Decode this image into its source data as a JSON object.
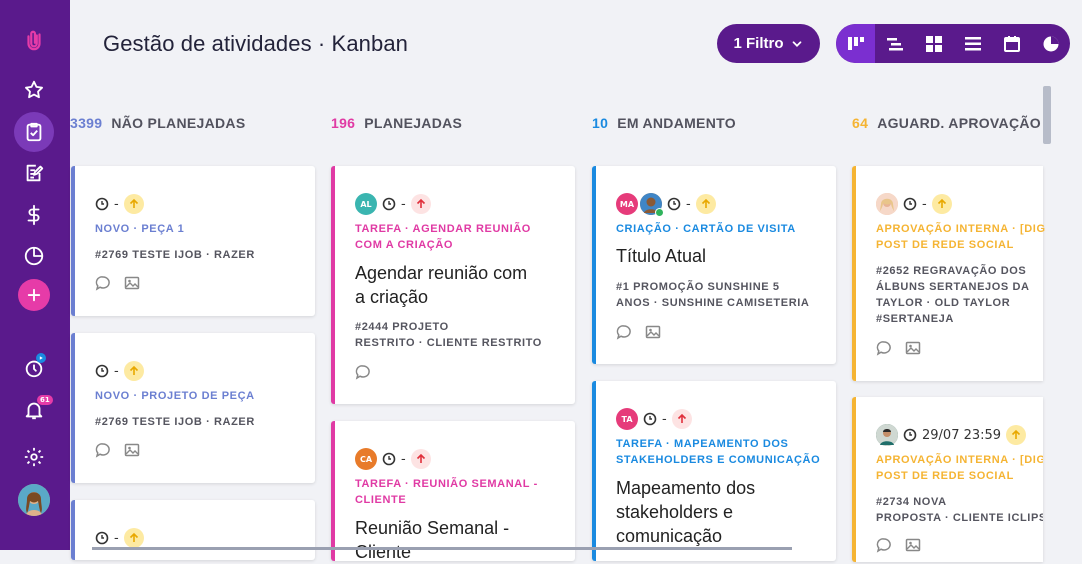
{
  "header": {
    "title": "Gestão de atividades · Kanban",
    "filter_label": "1 Filtro"
  },
  "views": [
    "kanban-icon",
    "gantt-icon",
    "grid-icon",
    "list-icon",
    "calendar-icon",
    "pie-chart-icon"
  ],
  "sidebar": {
    "items": [
      "logo-icon",
      "star-icon",
      "clipboard-check-icon",
      "edit-note-icon",
      "dollar-icon",
      "pie-chart-icon",
      "add-icon",
      "timer-icon",
      "bell-icon",
      "gear-icon",
      "avatar"
    ],
    "notification_badge": "61"
  },
  "colors": {
    "primary": "#5a1a8c",
    "accent": "#e63ba8",
    "blue": "#6b7fd1",
    "pink": "#e03aa4",
    "sky": "#1a8ae0",
    "amber": "#f5b433"
  },
  "columns": [
    {
      "count": "3399",
      "label": "NÃO PLANEJADAS",
      "count_color": "#6b7fd1"
    },
    {
      "count": "196",
      "label": "PLANEJADAS",
      "count_color": "#e03aa4"
    },
    {
      "count": "10",
      "label": "EM ANDAMENTO",
      "count_color": "#1a8ae0"
    },
    {
      "count": "64",
      "label": "AGUARD. APROVAÇÃO",
      "count_color": "#f5b433"
    }
  ],
  "cards": {
    "c1": {
      "due": "-",
      "category": "NOVO · PEÇA 1",
      "project_line1": "#2769 TESTE IJOB  ·  RAZER"
    },
    "c2": {
      "due": "-",
      "category": "NOVO · PROJETO DE PEÇA",
      "project_line1": "#2769 TESTE IJOB  ·  RAZER"
    },
    "c3": {
      "due": "-"
    },
    "p1": {
      "avatar": "AL",
      "due": "-",
      "category_line1": "TAREFA · AGENDAR REUNIÃO",
      "category_line2": "COM A CRIAÇÃO",
      "title_line1": "Agendar reunião com",
      "title_line2": "a criação",
      "project_line1": "#2444 PROJETO",
      "project_line2": "RESTRITO  ·  CLIENTE RESTRITO"
    },
    "p2": {
      "avatar": "CA",
      "due": "-",
      "category_line1": "TAREFA · REUNIÃO SEMANAL -",
      "category_line2": "CLIENTE",
      "title_line1": "Reunião Semanal -",
      "title_line2": "Cliente"
    },
    "e1": {
      "avatar": "MA",
      "due": "-",
      "category": "CRIAÇÃO · CARTÃO DE VISITA",
      "title": "Título Atual",
      "project_line1": "#1 PROMOÇÃO SUNSHINE 5",
      "project_line2": "ANOS  ·  SUNSHINE CAMISETERIA"
    },
    "e2": {
      "avatar": "TA",
      "due": "-",
      "category_line1": "TAREFA · MAPEAMENTO DOS",
      "category_line2": "STAKEHOLDERS E COMUNICAÇÃO",
      "title_line1": "Mapeamento dos",
      "title_line2": "stakeholders e",
      "title_line3": "comunicação"
    },
    "a1": {
      "due": "-",
      "category_line1": "APROVAÇÃO INTERNA · [DIG",
      "category_line2": "POST DE REDE SOCIAL",
      "project_line1": "#2652 REGRAVAÇÃO DOS",
      "project_line2": "ÁLBUNS SERTANEJOS DA",
      "project_line3": "TAYLOR  ·  OLD TAYLOR",
      "project_line4": "#SERTANEJA"
    },
    "a2": {
      "due": "29/07 23:59",
      "category_line1": "APROVAÇÃO INTERNA · [DIG",
      "category_line2": "POST DE REDE SOCIAL",
      "project_line1": "#2734 NOVA",
      "project_line2": "PROPOSTA  ·  CLIENTE ICLIPS"
    }
  }
}
